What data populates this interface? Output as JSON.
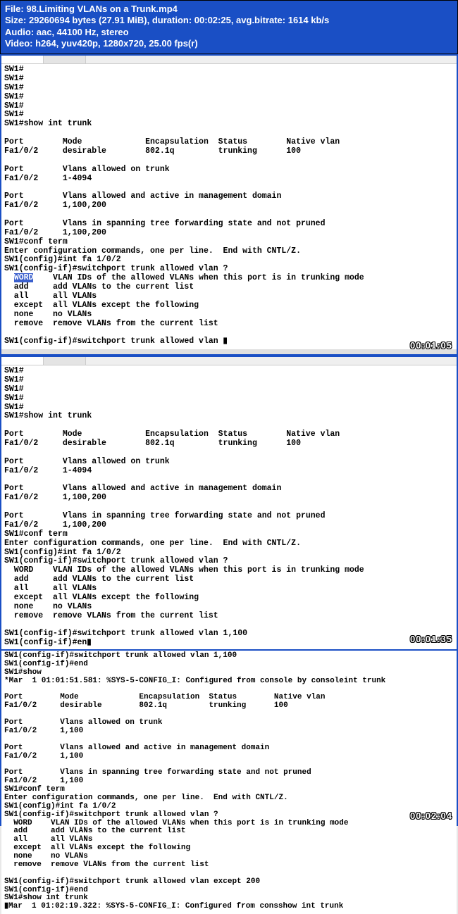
{
  "header": {
    "file_label": "File: ",
    "file_value": "98.Limiting VLANs on a Trunk.mp4",
    "size_label": "Size: ",
    "size_value": "29260694 bytes (27.91 MiB), duration: 00:02:25, avg.bitrate: 1614 kb/s",
    "audio_label": "Audio: ",
    "audio_value": "aac, 44100 Hz, stereo",
    "video_label": "Video: ",
    "video_value": "h264, yuv420p, 1280x720, 25.00 fps(r)"
  },
  "frames": [
    {
      "timestamp": "00:01:05",
      "lines": [
        "SW1#",
        "SW1#",
        "SW1#",
        "SW1#",
        "SW1#",
        "SW1#",
        "SW1#show int trunk",
        "",
        "Port        Mode             Encapsulation  Status        Native vlan",
        "Fa1/0/2     desirable        802.1q         trunking      100",
        "",
        "Port        Vlans allowed on trunk",
        "Fa1/0/2     1-4094",
        "",
        "Port        Vlans allowed and active in management domain",
        "Fa1/0/2     1,100,200",
        "",
        "Port        Vlans in spanning tree forwarding state and not pruned",
        "Fa1/0/2     1,100,200",
        "SW1#conf term",
        "Enter configuration commands, one per line.  End with CNTL/Z.",
        "SW1(config)#int fa 1/0/2",
        "SW1(config-if)#switchport trunk allowed vlan ?",
        "  WORD    VLAN IDs of the allowed VLANs when this port is in trunking mode",
        "  add     add VLANs to the current list",
        "  all     all VLANs",
        "  except  all VLANs except the following",
        "  none    no VLANs",
        "  remove  remove VLANs from the current list",
        "",
        "SW1(config-if)#switchport trunk allowed vlan ▮"
      ],
      "highlight_line": 23,
      "highlight_col": 2,
      "highlight_len": 4
    },
    {
      "timestamp": "00:01:35",
      "lines": [
        "SW1#",
        "SW1#",
        "SW1#",
        "SW1#",
        "SW1#",
        "SW1#show int trunk",
        "",
        "Port        Mode             Encapsulation  Status        Native vlan",
        "Fa1/0/2     desirable        802.1q         trunking      100",
        "",
        "Port        Vlans allowed on trunk",
        "Fa1/0/2     1-4094",
        "",
        "Port        Vlans allowed and active in management domain",
        "Fa1/0/2     1,100,200",
        "",
        "Port        Vlans in spanning tree forwarding state and not pruned",
        "Fa1/0/2     1,100,200",
        "SW1#conf term",
        "Enter configuration commands, one per line.  End with CNTL/Z.",
        "SW1(config)#int fa 1/0/2",
        "SW1(config-if)#switchport trunk allowed vlan ?",
        "  WORD    VLAN IDs of the allowed VLANs when this port is in trunking mode",
        "  add     add VLANs to the current list",
        "  all     all VLANs",
        "  except  all VLANs except the following",
        "  none    no VLANs",
        "  remove  remove VLANs from the current list",
        "",
        "SW1(config-if)#switchport trunk allowed vlan 1,100",
        "SW1(config-if)#en▮"
      ]
    },
    {
      "timestamp": "00:02:04",
      "lines": [
        "SW1(config-if)#switchport trunk allowed vlan 1,100",
        "SW1(config-if)#end",
        "SW1#show",
        "*Mar  1 01:01:51.581: %SYS-5-CONFIG_I: Configured from console by consoleint trunk",
        "",
        "Port        Mode             Encapsulation  Status        Native vlan",
        "Fa1/0/2     desirable        802.1q         trunking      100",
        "",
        "Port        Vlans allowed on trunk",
        "Fa1/0/2     1,100",
        "",
        "Port        Vlans allowed and active in management domain",
        "Fa1/0/2     1,100",
        "",
        "Port        Vlans in spanning tree forwarding state and not pruned",
        "Fa1/0/2     1,100",
        "SW1#conf term",
        "Enter configuration commands, one per line.  End with CNTL/Z.",
        "SW1(config)#int fa 1/0/2",
        "SW1(config-if)#switchport trunk allowed vlan ?",
        "  WORD    VLAN IDs of the allowed VLANs when this port is in trunking mode",
        "  add     add VLANs to the current list",
        "  all     all VLANs",
        "  except  all VLANs except the following",
        "  none    no VLANs",
        "  remove  remove VLANs from the current list",
        "",
        "SW1(config-if)#switchport trunk allowed vlan except 200",
        "SW1(config-if)#end",
        "SW1#show int trunk",
        "▮Mar  1 01:02:19.322: %SYS-5-CONFIG_I: Configured from consshow int trunk"
      ]
    }
  ]
}
